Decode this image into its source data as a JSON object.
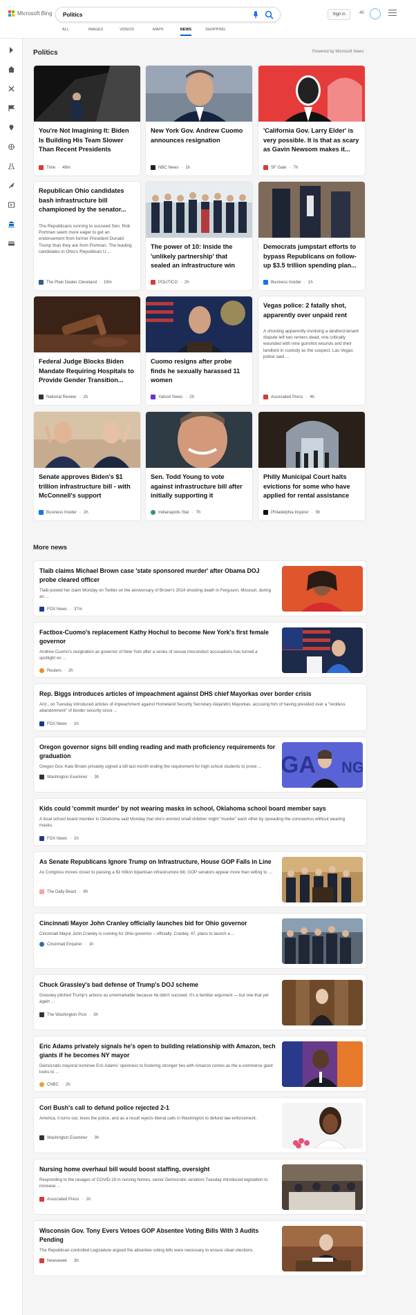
{
  "header": {
    "logo_text": "Microsoft Bing",
    "search_value": "Politics",
    "signin": "Sign in",
    "points": "40",
    "tabs": [
      "ALL",
      "IMAGES",
      "VIDEOS",
      "MAPS",
      "NEWS",
      "SHOPPING"
    ],
    "active_tab": "NEWS"
  },
  "sidebar": {
    "icons": [
      "chevron-right-icon",
      "home-icon",
      "sports-icon",
      "flag-icon",
      "location-icon",
      "globe-icon",
      "science-icon",
      "rocket-icon",
      "entertainment-icon",
      "politics-icon",
      "money-icon"
    ]
  },
  "page": {
    "title": "Politics",
    "powered": "Powered by Microsoft News"
  },
  "grid": [
    {
      "headline": "You're Not Imagining It: Biden Is Building His Team Slower Than Recent Presidents",
      "source": "Time",
      "time": "48m",
      "color": "#d83b3b"
    },
    {
      "headline": "New York Gov. Andrew Cuomo announces resignation",
      "source": "NBC News",
      "time": "1h",
      "color": "#222222"
    },
    {
      "headline": "'California Gov. Larry Elder' is very possible. It is that as scary as Gavin Newsom makes it...",
      "source": "SF Gate",
      "time": "7h",
      "color": "#d83b3b"
    },
    {
      "headline": "Republican Ohio candidates bash infrastructure bill championed by the senator...",
      "snippet": "The Republicans running to succeed Sen. Rob Portman seem more eager to get an endorsement from former President Donald Trump than they are from Portman. The leading candidates in Ohio's Republican U ...",
      "source": "The Plain Dealer Cleveland",
      "time": "19m",
      "color": "#2f5f8a"
    },
    {
      "headline": "The power of 10: Inside the 'unlikely partnership' that sealed an infrastructure win",
      "source": "POLITICO",
      "time": "2h",
      "color": "#d83b3b"
    },
    {
      "headline": "Democrats jumpstart efforts to bypass Republicans on follow-up $3.5 trillion spending plan...",
      "source": "Business Insider",
      "time": "1h",
      "color": "#1a73e8"
    },
    {
      "headline": "Federal Judge Blocks Biden Mandate Requiring Hospitals to Provide Gender Transition...",
      "source": "National Review",
      "time": "1h",
      "color": "#333333"
    },
    {
      "headline": "Cuomo resigns after probe finds he sexually harassed 11 women",
      "source": "Yahoo! News",
      "time": "2h",
      "color": "#6b2fd6"
    },
    {
      "headline": "Vegas police: 2 fatally shot, apparently over unpaid rent",
      "snippet": "A shooting apparently involving a landlord-tenant dispute left two renters dead, one critically wounded with nine gunshot wounds and their landlord in custody as the suspect, Las Vegas police said ...",
      "source": "Associated Press",
      "time": "4h",
      "color": "#d83b3b"
    },
    {
      "headline": "Senate approves Biden's $1 trillion infrastructure bill - with McConnell's support",
      "source": "Business Insider",
      "time": "2h",
      "color": "#1a73e8"
    },
    {
      "headline": "Sen. Todd Young to vote against infrastructure bill after initially supporting it",
      "source": "Indianapolis Star",
      "time": "7h",
      "color": "#2e9a6a"
    },
    {
      "headline": "Philly Municipal Court halts evictions for some who have applied for rental assistance",
      "source": "Philadelphia Inquirer",
      "time": "5h",
      "color": "#111111"
    }
  ],
  "more_news_title": "More news",
  "more": [
    {
      "headline": "Tlaib claims Michael Brown case 'state sponsored murder' after Obama DOJ probe cleared officer",
      "snippet": "Tlaib posted her claim Monday on Twitter on the anniversary of Brown's 2014 shooting death in Ferguson, Missouri, during an ...",
      "source": "FOX News",
      "time": "37m",
      "color": "#1b3a8a"
    },
    {
      "headline": "Factbox-Cuomo's replacement Kathy Hochul to become New York's first female governor",
      "snippet": "Andrew Cuomo's resignation as governor of New York after a series of sexual misconduct accusations has turned a spotlight on ...",
      "source": "Reuters",
      "time": "2h",
      "color": "#f08a24"
    },
    {
      "headline": "Rep. Biggs introduces articles of impeachment against DHS chief Mayorkas over border crisis",
      "snippet": "Ariz., on Tuesday introduced articles of impeachment against Homeland Security Secretary Alejandro Mayorkas, accusing him of having presided over a \"reckless abandonment\" of border security since ...",
      "source": "FOX News",
      "time": "1h",
      "color": "#1b3a8a"
    },
    {
      "headline": "Oregon governor signs bill ending reading and math proficiency requirements for graduation",
      "snippet": "Oregon Gov. Kate Brown privately signed a bill last month ending the requirement for high school students to prove ...",
      "source": "Washington Examiner",
      "time": "3h",
      "color": "#333333"
    },
    {
      "headline": "Kids could 'commit murder' by not wearing masks in school, Oklahoma school board member says",
      "snippet": "A local school board member in Oklahoma said Monday that she's worried small children might \"murder\" each other by spreading the coronavirus without wearing masks.",
      "source": "FOX News",
      "time": "1h",
      "color": "#1b3a8a"
    },
    {
      "headline": "As Senate Republicans Ignore Trump on Infrastructure, House GOP Falls in Line",
      "snippet": "As Congress moves closer to passing a $1 trillion bipartisan infrastructure bill, GOP senators appear more than willing to ...",
      "source": "The Daily Beast",
      "time": "9h",
      "color": "#f4a6a6"
    },
    {
      "headline": "Cincinnati Mayor John Cranley officially launches bid for Ohio governor",
      "snippet": "Cincinnati Mayor John Cranley is running for Ohio governor – officially. Cranley, 47, plans to launch a ...",
      "source": "Cincinnati Enquirer",
      "time": "1h",
      "color": "#2b6cb0"
    },
    {
      "headline": "Chuck Grassley's bad defense of Trump's DOJ scheme",
      "snippet": "Grassley pitched Trump's actions as unremarkable because he didn't succeed. It's a familiar argument — but one that yet again ...",
      "source": "The Washington Post",
      "time": "3h",
      "color": "#333333"
    },
    {
      "headline": "Eric Adams privately signals he's open to building relationship with Amazon, tech giants if he becomes NY mayor",
      "snippet": "Democratic mayoral nominee Eric Adams' openness to fostering stronger ties with Amazon comes as the e-commerce giant looks to ...",
      "source": "CNBC",
      "time": "2h",
      "color": "#e8a13a"
    },
    {
      "headline": "Cori Bush's call to defund police rejected 2-1",
      "snippet": "America, it turns out, loves the police, and as a result rejects liberal calls in Washington to defund law enforcement.",
      "source": "Washington Examiner",
      "time": "3h",
      "color": "#333333"
    },
    {
      "headline": "Nursing home overhaul bill would boost staffing, oversight",
      "snippet": "Responding to the ravages of COVID-19 in nursing homes, senior Democratic senators Tuesday introduced legislation to increase ...",
      "source": "Associated Press",
      "time": "1h",
      "color": "#d83b3b"
    },
    {
      "headline": "Wisconsin Gov. Tony Evers Vetoes GOP Absentee Voting Bills With 3 Audits Pending",
      "snippet": "The Republican-controlled Legislature argued the absentee voting bills were necessary to ensure clean elections.",
      "source": "Newsweek",
      "time": "3h",
      "color": "#d83b3b"
    }
  ]
}
